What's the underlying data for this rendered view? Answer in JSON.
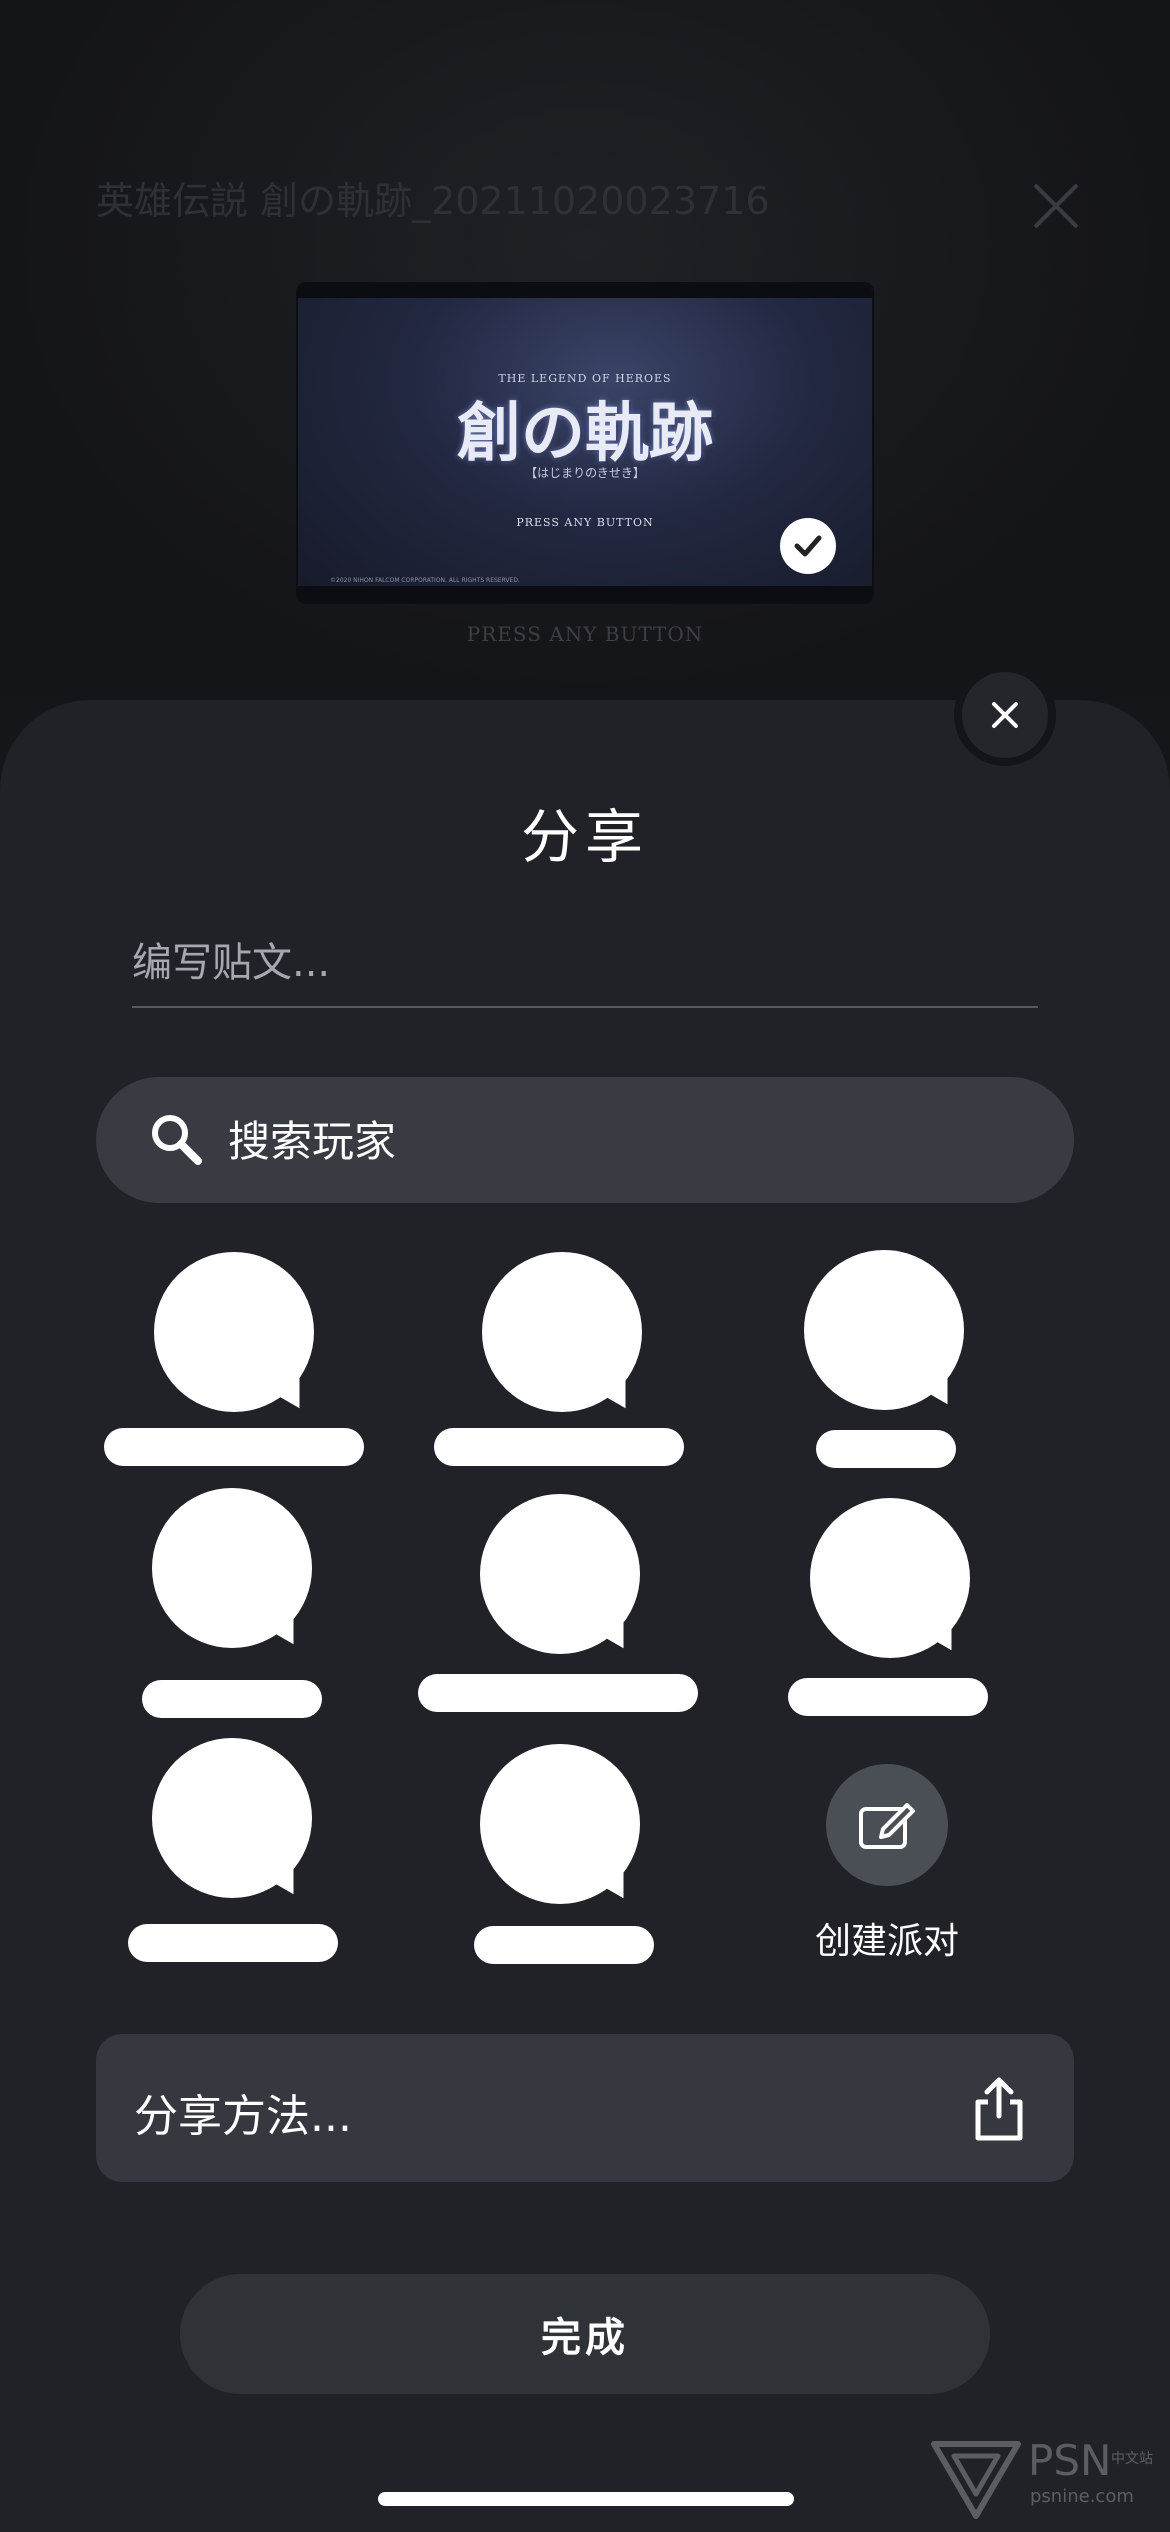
{
  "background": {
    "title": "英雄伝説 創の軌跡_20211020023716",
    "press_text": "PRESS ANY BUTTON"
  },
  "thumbnail": {
    "subtitle": "THE LEGEND OF HEROES",
    "logo": "創の軌跡",
    "tagline": "【はじまりのきせき】",
    "press_text": "PRESS ANY BUTTON",
    "copyright": "©2020 NIHON FALCOM CORPORATION. ALL RIGHTS RESERVED.",
    "selected": true
  },
  "sheet": {
    "title": "分享",
    "post_placeholder": "编写贴文...",
    "search_placeholder": "搜索玩家",
    "players": [
      {
        "name": "",
        "redacted": true
      },
      {
        "name": "",
        "redacted": true
      },
      {
        "name": "",
        "redacted": true
      },
      {
        "name": "",
        "redacted": true
      },
      {
        "name": "",
        "redacted": true
      },
      {
        "name": "",
        "redacted": true
      },
      {
        "name": "",
        "redacted": true
      },
      {
        "name": "",
        "redacted": true
      }
    ],
    "create_party_label": "创建派对",
    "share_method_label": "分享方法...",
    "done_label": "完成"
  },
  "watermark": {
    "brand": "PSN",
    "brand_cn": "中文站",
    "url": "psnine.com"
  },
  "icons": {
    "close": "close-icon",
    "check": "check-icon",
    "search": "search-icon",
    "share": "share-icon",
    "party": "edit-icon"
  }
}
